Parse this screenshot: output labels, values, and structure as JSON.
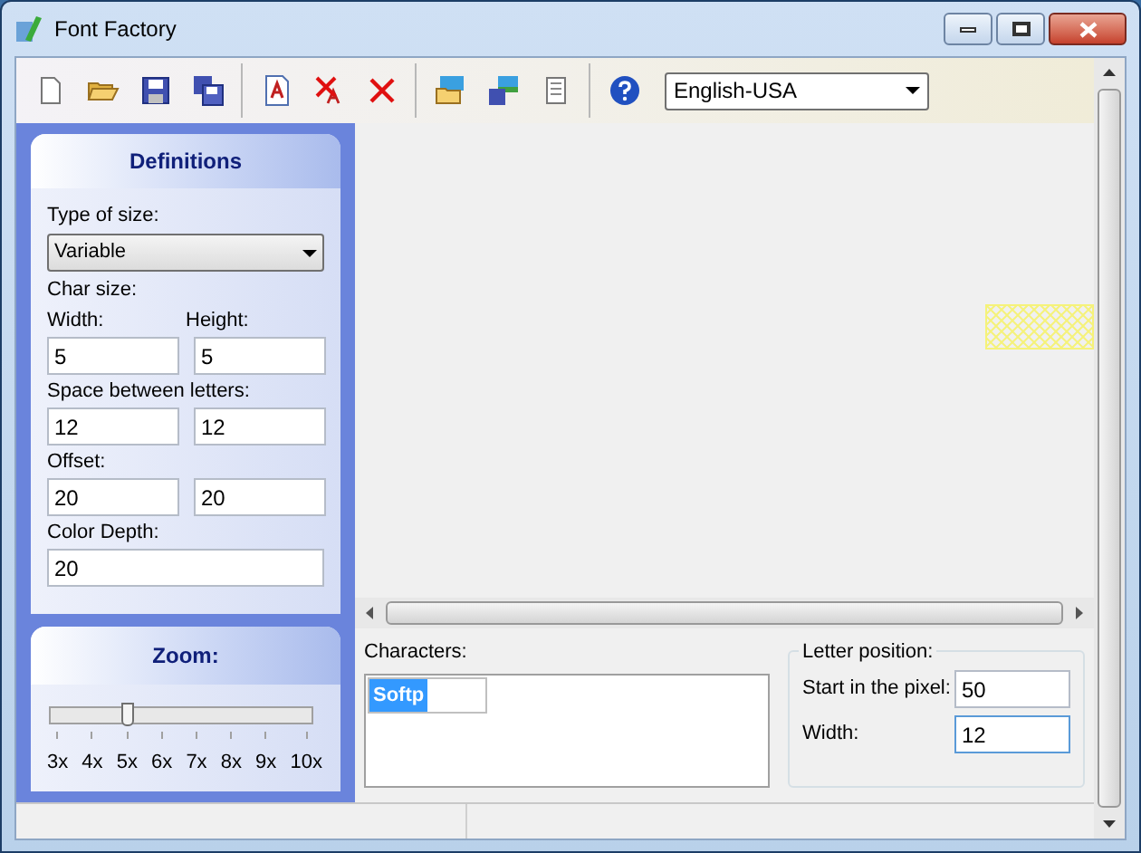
{
  "window": {
    "title": "Font Factory"
  },
  "toolbar": {
    "language": "English-USA"
  },
  "definitions": {
    "title": "Definitions",
    "type_of_size": {
      "label": "Type of size:",
      "value": "Variable"
    },
    "char_size_label": "Char size:",
    "rows": [
      {
        "labels": [
          "Width:",
          "Height:"
        ],
        "values": [
          "5",
          "5"
        ]
      },
      {
        "labels": [
          "Space between letters:"
        ],
        "values": [
          "12",
          "12"
        ]
      },
      {
        "labels": [
          "Offset:"
        ],
        "values": [
          "20",
          "20"
        ]
      },
      {
        "labels": [
          "Color Depth:"
        ],
        "values": [
          "20"
        ]
      }
    ]
  },
  "zoom": {
    "title": "Zoom:",
    "level": 0.2857,
    "ticks": [
      "3x",
      "4x",
      "5x",
      "6x",
      "7x",
      "8x",
      "9x",
      "10x"
    ]
  },
  "characters": {
    "label": "Characters:",
    "items": [
      {
        "text": "Softp",
        "selected": true
      }
    ]
  },
  "letter_position": {
    "title": "Letter position:",
    "fields": [
      {
        "label": "Start in the pixel:",
        "value": "50",
        "focused": false
      },
      {
        "label": "Width:",
        "value": "12",
        "focused": true
      }
    ]
  }
}
